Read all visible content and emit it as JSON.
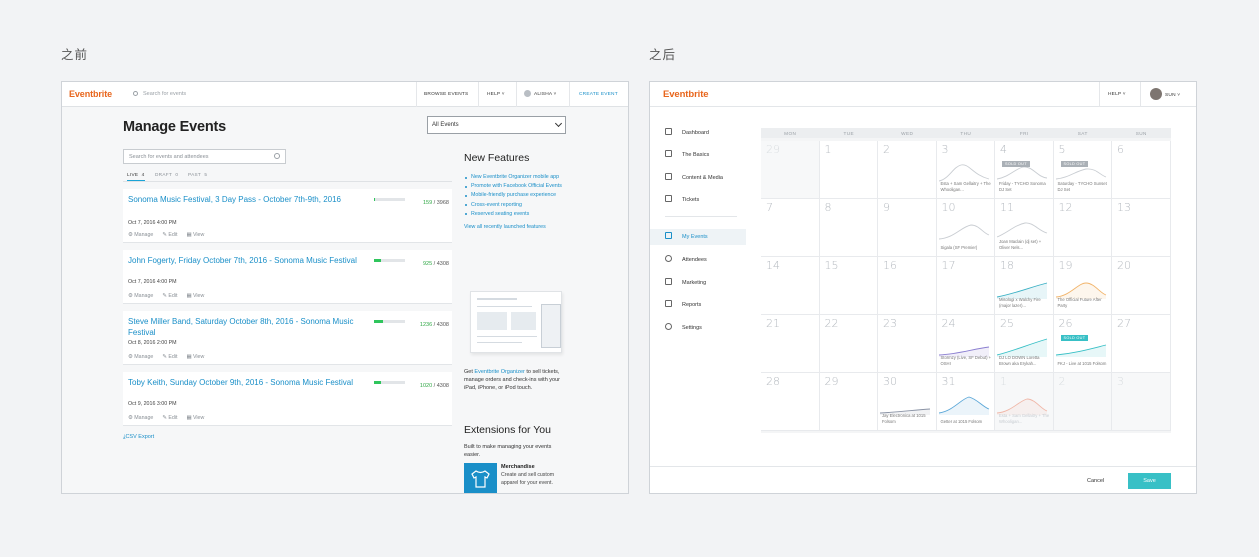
{
  "captions": {
    "before": "之前",
    "after": "之后"
  },
  "before": {
    "nav": {
      "logo": "Eventbrite",
      "search_placeholder": "Search for events",
      "browse": "BROWSE EVENTS",
      "help": "HELP",
      "user": "ALISHA",
      "create": "CREATE EVENT"
    },
    "title": "Manage Events",
    "filter_select": "All Events",
    "search_placeholder": "Search for events and attendees",
    "tabs": [
      {
        "label": "LIVE",
        "count": "4"
      },
      {
        "label": "DRAFT",
        "count": "0"
      },
      {
        "label": "PAST",
        "count": "5"
      }
    ],
    "events": [
      {
        "title": "Sonoma Music Festival, 3 Day Pass - October 7th-9th, 2016",
        "date": "Oct 7, 2016 4:00 PM",
        "sold": "159",
        "total": "3968",
        "progress": 0.04
      },
      {
        "title": "John Fogerty, Friday October 7th, 2016 - Sonoma Music Festival",
        "date": "Oct 7, 2016 4:00 PM",
        "sold": "925",
        "total": "4308",
        "progress": 0.21
      },
      {
        "title": "Steve Miller Band, Saturday October 8th, 2016 - Sonoma Music Festival",
        "date": "Oct 8, 2016 2:00 PM",
        "sold": "1236",
        "total": "4308",
        "progress": 0.29
      },
      {
        "title": "Toby Keith, Sunday October 9th, 2016 - Sonoma Music Festival",
        "date": "Oct 9, 2016 3:00 PM",
        "sold": "1020",
        "total": "4308",
        "progress": 0.24
      }
    ],
    "actions": {
      "manage": "Manage",
      "edit": "Edit",
      "view": "View"
    },
    "csv_export": "CSV Export",
    "new_features": {
      "heading": "New Features",
      "items": [
        "New Eventbrite Organizer mobile app",
        "Promote with Facebook Official Events",
        "Mobile-friendly purchase experience",
        "Cross-event reporting",
        "Reserved seating events"
      ],
      "view_all": "View all recently launched features"
    },
    "get_organizer": {
      "prefix": "Get ",
      "link": "Eventbrite Organizer",
      "suffix": " to sell tickets, manage orders and check-ins with your iPad, iPhone, or iPod touch."
    },
    "extensions": {
      "heading": "Extensions for You",
      "desc": "Built to make managing your events easier.",
      "item_title": "Merchandise",
      "item_desc": "Create and sell custom apparel for your event."
    }
  },
  "after": {
    "nav": {
      "logo": "Eventbrite",
      "help": "HELP",
      "user": "SUN"
    },
    "sidebar": [
      "Dashboard",
      "The Basics",
      "Content & Media",
      "Tickets",
      "My Events",
      "Attendees",
      "Marketing",
      "Reports",
      "Settings"
    ],
    "weekdays": [
      "MON",
      "TUE",
      "WED",
      "THU",
      "FRI",
      "SAT",
      "SUN"
    ],
    "days": [
      "29",
      "1",
      "2",
      "3",
      "4",
      "5",
      "6",
      "7",
      "8",
      "9",
      "10",
      "11",
      "12",
      "13",
      "14",
      "15",
      "16",
      "17",
      "18",
      "19",
      "20",
      "21",
      "22",
      "23",
      "24",
      "25",
      "26",
      "27",
      "28",
      "29",
      "30",
      "31",
      "1",
      "2",
      "3"
    ],
    "events": [
      {
        "day": 3,
        "text": "Esta + Sam Gellaitry + The Whooligan..."
      },
      {
        "day": 4,
        "text": "Friday - TYCHO Sonoma DJ Set",
        "badge": "SOLD OUT"
      },
      {
        "day": 5,
        "text": "Saturday - TYCHO Sunset DJ Set",
        "badge": "SOLD OUT"
      },
      {
        "day": 10,
        "text": "Sigala (SF Premier)"
      },
      {
        "day": 11,
        "text": "Joan Maclain (dj set) + Oliver Nels..."
      },
      {
        "day": 18,
        "text": "Misologi x Walchy Fire (major lazer)..."
      },
      {
        "day": 19,
        "text": "The Official Future After Party"
      },
      {
        "day": 24,
        "text": "Stormzy (Live, SF Debut) + OSHI"
      },
      {
        "day": 25,
        "text": "DJ LO DOWN Loretta Brown aka Erykah..."
      },
      {
        "day": 26,
        "text": "FKJ - Live at 1015 Folsom",
        "badge": "SOLD OUT"
      },
      {
        "day": 30,
        "text": "Jay Electronica at 1015 Folsom"
      },
      {
        "day": 31,
        "text": "Getter at 1015 Folsom"
      },
      {
        "day": 32,
        "text": "Esta + Sam Gellaitry + The Whooligan..."
      }
    ],
    "footer": {
      "cancel": "Cancel",
      "save": "Save"
    }
  }
}
